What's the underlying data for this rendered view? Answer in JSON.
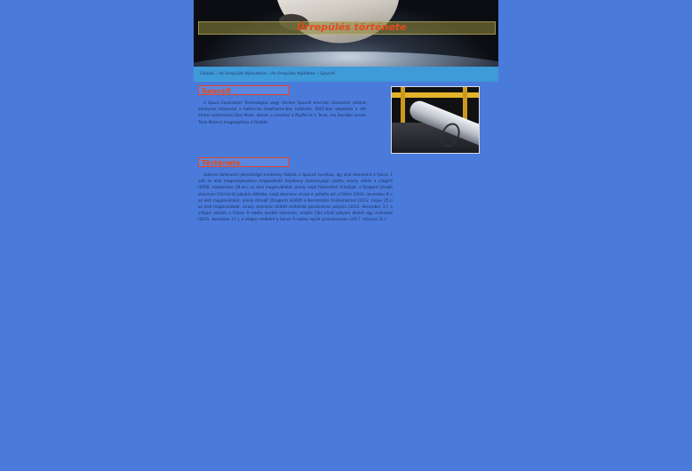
{
  "header": {
    "site_title": "Űrrepülés története"
  },
  "breadcrumb": [
    "Főoldal",
    "Az űrrepülés fejlesztése",
    "Az űrrepülés fejlődése",
    "SpaceX"
  ],
  "sections": [
    {
      "heading": "SpaceX",
      "text": "A Space Exploration Technologies vagy röviden SpaceX amerikai űrkutatási vállalat, amelynek központja a kaliforniai Hawthorne-ban található. 2002-ben alapította a dél-afrikai származású Elon Musk, akinek a nevéhez a PayPal és a Tesla, ma (korábbi nevén: Tesla Motors) megalapítása is fűződik."
    },
    {
      "heading": "Története",
      "text": "Számos történelmi jelentőségű eredmény fűződik a SpaceX nevéhez, így első sikereként a Falcon 1 volt az első magánfejlesztésű magaslöketű folyékony üzemanyagú rakéta, amely elérte a világűrt (2008. szeptember 28-án); az első magánvállalat, amely sajat fejlesztésű űrhajóját, a Dragont űrhajót sikeresen Föld körüli pályára állította, majd sikeresen vissza is juttatta azt a Földre (2010. december 8-); az első magánvállalat, amely űrhajót (Dragont) küldött a Nemzetközi Űrállomáshoz (2012. május 25.); az első magánvállalat, amely sikeresen állított műholdat geoszinkron pályára (2013. december 3.); a világon először a Falcon 9 rakéta landolt sikeresen, miután Föld körüli pályára állított egy műholdat (2015. december 21.); a világon elsőként a Falcon 9 rakéta repült újrahasznosan (2017. március 31.)."
    }
  ],
  "photo": {
    "alt": "Falcon 9 rakéta a szerelőcsarnokban"
  }
}
